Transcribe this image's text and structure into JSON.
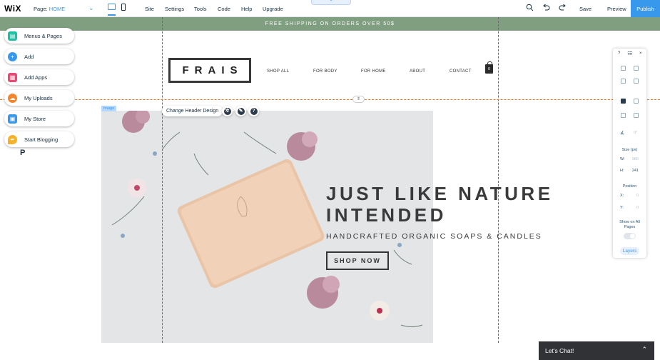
{
  "topbar": {
    "logo": "WiX",
    "page_label": "Page:",
    "page_value": "HOME",
    "menu": [
      "Site",
      "Settings",
      "Tools",
      "Code",
      "Help",
      "Upgrade"
    ],
    "save": "Save",
    "preview": "Preview",
    "publish": "Publish",
    "icons": [
      "zoom-icon",
      "undo-icon",
      "redo-icon"
    ]
  },
  "left_panel": {
    "items": [
      {
        "label": "Menus & Pages",
        "icon": "pages-icon",
        "color": "#1fbfa5"
      },
      {
        "label": "Add",
        "icon": "plus-icon",
        "color": "#3899ec"
      },
      {
        "label": "Add Apps",
        "icon": "apps-icon",
        "color": "#e84b74"
      },
      {
        "label": "My Uploads",
        "icon": "cloud-upload-icon",
        "color": "#f5862d"
      },
      {
        "label": "My Store",
        "icon": "shopping-bag-icon",
        "color": "#3899ec"
      },
      {
        "label": "Start Blogging",
        "icon": "pen-nib-icon",
        "color": "#f5b128"
      }
    ],
    "pin_icon": "P"
  },
  "site": {
    "shipping_banner": "FREE SHIPPING ON ORDERS OVER 50$",
    "logo_text": "FRAIS",
    "nav": [
      "SHOP ALL",
      "FOR BODY",
      "FOR HOME",
      "ABOUT",
      "CONTACT"
    ],
    "cart_count": "0",
    "image_tag": "Image",
    "change_header": "Change Header Design",
    "hero_title_line1": "JUST LIKE NATURE",
    "hero_title_line2": "INTENDED",
    "hero_subtitle": "HANDCRAFTED ORGANIC SOAPS & CANDLES",
    "hero_button": "SHOP NOW"
  },
  "inspector": {
    "help": "?",
    "close": "×",
    "rotation": "0°",
    "size_label": "Size (px)",
    "w_label": "W:",
    "w_value": "980",
    "h_label": "H:",
    "h_value": "241",
    "position_label": "Position",
    "x_label": "X:",
    "x_value": "0",
    "y_label": "Y:",
    "y_value": "0",
    "show_all_pages": "Show on All Pages",
    "layers": "Layers"
  },
  "chat": {
    "label": "Let's Chat!"
  },
  "colors": {
    "accent": "#3899ec",
    "shipbar": "#809e80",
    "header_guide": "#f0741a"
  }
}
